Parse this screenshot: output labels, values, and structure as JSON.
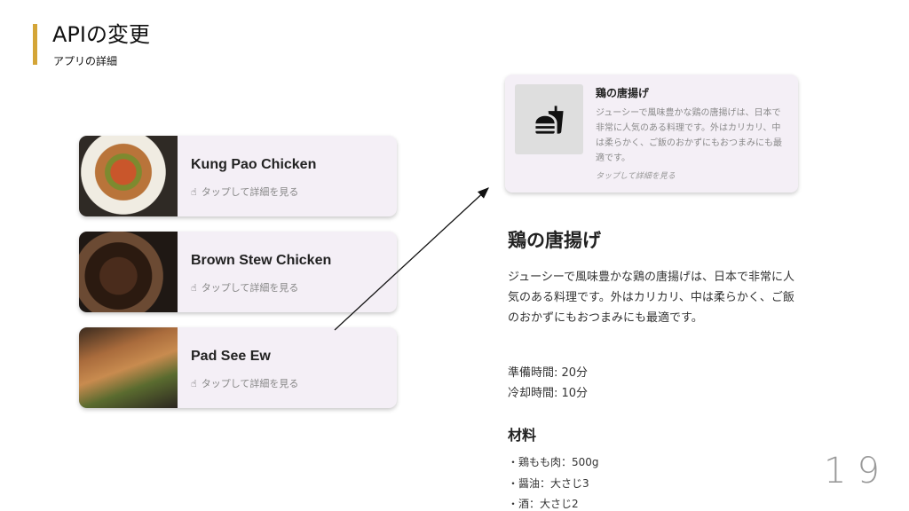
{
  "slide": {
    "title": "APIの変更",
    "subtitle": "アプリの詳細",
    "page_number": "19",
    "accent_color": "#d4a537"
  },
  "list": {
    "tap_icon": "hand-pointer-icon",
    "items": [
      {
        "name": "Kung Pao Chicken",
        "hint": "タップして詳細を見る"
      },
      {
        "name": "Brown Stew Chicken",
        "hint": "タップして詳細を見る"
      },
      {
        "name": "Pad See Ew",
        "hint": "タップして詳細を見る"
      }
    ]
  },
  "preview": {
    "icon": "fastfood-icon",
    "title": "鶏の唐揚げ",
    "description": "ジューシーで風味豊かな鶏の唐揚げは、日本で非常に人気のある料理です。外はカリカリ、中は柔らかく、ご飯のおかずにもおつまみにも最適です。",
    "hint": "タップして詳細を見る"
  },
  "detail": {
    "title": "鶏の唐揚げ",
    "description": "ジューシーで風味豊かな鶏の唐揚げは、日本で非常に人気のある料理です。外はカリカリ、中は柔らかく、ご飯のおかずにもおつまみにも最適です。",
    "prep_time": "準備時間: 20分",
    "cool_time": "冷却時間: 10分",
    "ingredients_heading": "材料",
    "ingredients": [
      "・鶏もも肉：500g",
      "・醤油：大さじ3",
      "・酒：大さじ2"
    ]
  }
}
